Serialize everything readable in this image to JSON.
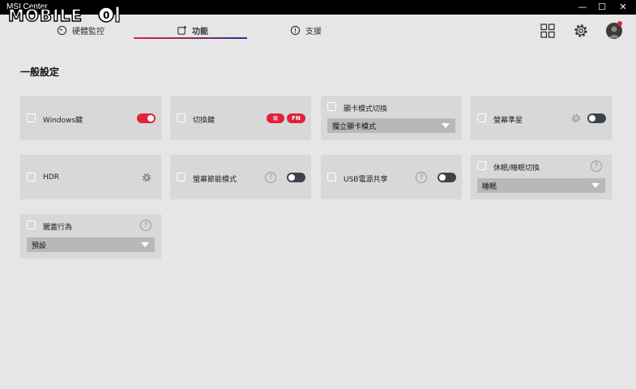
{
  "app": {
    "title": "MSI Center",
    "logo_text": "MOBILE01"
  },
  "window_controls": {
    "minimize": "—",
    "maximize": "☐",
    "close": "✕"
  },
  "tabs": [
    {
      "label": "硬體監控",
      "icon": "gauge-icon",
      "active": false
    },
    {
      "label": "功能",
      "icon": "feature-icon",
      "active": true
    },
    {
      "label": "支援",
      "icon": "support-icon",
      "active": false
    }
  ],
  "header_icons": [
    "grid-icon",
    "gear-icon",
    "avatar"
  ],
  "section": {
    "title": "一般設定"
  },
  "features": [
    {
      "label": "Windows鍵",
      "control": "toggle",
      "state": "on"
    },
    {
      "label": "切換鍵",
      "control": "pills",
      "pills": [
        "⊞",
        "FN"
      ]
    },
    {
      "label": "顯卡模式切換",
      "control": "dropdown",
      "value": "獨立顯卡模式"
    },
    {
      "label": "螢幕準星",
      "control": "toggle",
      "state": "off",
      "has_settings": true
    },
    {
      "label": "HDR",
      "control": "settings"
    },
    {
      "label": "螢幕節能模式",
      "control": "toggle",
      "state": "off",
      "has_help": true,
      "help": "?"
    },
    {
      "label": "USB電源共享",
      "control": "toggle",
      "state": "off",
      "has_help": true,
      "help": "?"
    },
    {
      "label": "休眠/睡眠切換",
      "control": "dropdown",
      "value": "睡眠",
      "has_help": true,
      "help": "?"
    },
    {
      "label": "闔蓋行為",
      "control": "dropdown",
      "value": "預設",
      "has_help": true,
      "help": "?"
    }
  ],
  "colors": {
    "accent": "#e0233a",
    "toggle_off": "#3d434d",
    "card_bg": "#d8d8d8",
    "page_bg": "#e6e6e6"
  }
}
